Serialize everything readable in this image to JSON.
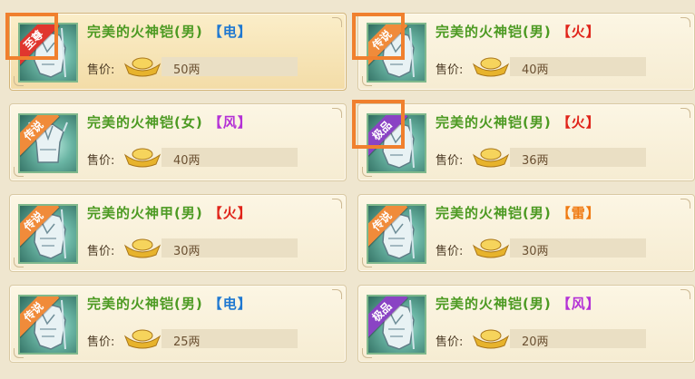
{
  "colors": {
    "tag_electric": "#1f78d1",
    "tag_wind": "#b431d6",
    "tag_fire": "#e0241a",
    "tag_thunder": "#f07a12",
    "ribbon_legend": "#f08b3a",
    "ribbon_epic": "#8a43c4",
    "ribbon_supreme": "#e0362e",
    "item_name": "#4c9a22"
  },
  "price_label": "售价:",
  "items": [
    {
      "name": "完美的火神铠(男)",
      "tag": "【电】",
      "price": "50两",
      "ribbon": "至尊"
    },
    {
      "name": "完美的火神铠(男)",
      "tag": "【火】",
      "price": "40两",
      "ribbon": "传说"
    },
    {
      "name": "完美的火神铠(女)",
      "tag": "【风】",
      "price": "40两",
      "ribbon": "传说"
    },
    {
      "name": "完美的火神铠(男)",
      "tag": "【火】",
      "price": "36两",
      "ribbon": "极品"
    },
    {
      "name": "完美的火神甲(男)",
      "tag": "【火】",
      "price": "30两",
      "ribbon": "传说"
    },
    {
      "name": "完美的火神铠(男)",
      "tag": "【雷】",
      "price": "30两",
      "ribbon": "传说"
    },
    {
      "name": "完美的火神铠(男)",
      "tag": "【电】",
      "price": "25两",
      "ribbon": "传说"
    },
    {
      "name": "完美的火神铠(男)",
      "tag": "【风】",
      "price": "20两",
      "ribbon": "极品"
    }
  ]
}
